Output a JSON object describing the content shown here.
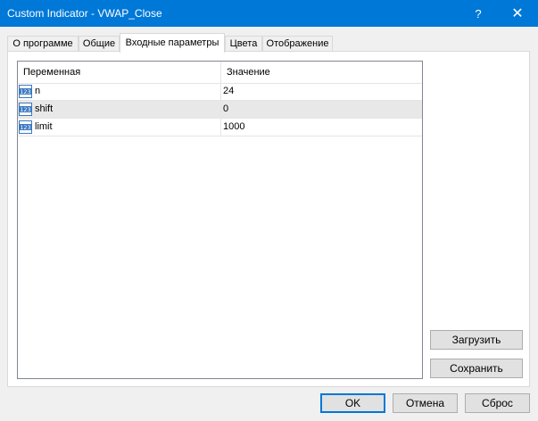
{
  "window": {
    "title": "Custom Indicator - VWAP_Close",
    "help_glyph": "?",
    "close_glyph": "✕"
  },
  "tabs": [
    {
      "label": "О программе",
      "active": false
    },
    {
      "label": "Общие",
      "active": false
    },
    {
      "label": "Входные параметры",
      "active": true
    },
    {
      "label": "Цвета",
      "active": false
    },
    {
      "label": "Отображение",
      "active": false
    }
  ],
  "grid": {
    "columns": {
      "variable": "Переменная",
      "value": "Значение"
    },
    "rows": [
      {
        "name": "n",
        "value": "24",
        "icon": "numeric-123-icon"
      },
      {
        "name": "shift",
        "value": "0",
        "icon": "numeric-123-icon"
      },
      {
        "name": "limit",
        "value": "1000",
        "icon": "numeric-123-icon"
      }
    ],
    "icon_text": "123"
  },
  "side_buttons": {
    "load": "Загрузить",
    "save": "Сохранить"
  },
  "footer_buttons": {
    "ok": "OK",
    "cancel": "Отмена",
    "reset": "Сброс"
  },
  "colors": {
    "titlebar": "#0078d7",
    "selected_row": "#e8e8e8",
    "icon_blue": "#3a78c3"
  }
}
